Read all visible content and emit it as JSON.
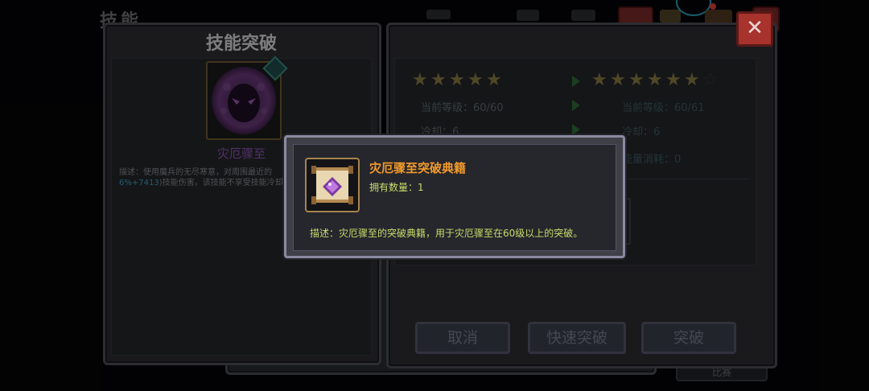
{
  "background_window": {
    "title": "技能"
  },
  "left_panel": {
    "title": "技能突破",
    "skill_name": "灾厄骤至",
    "description_prefix": "描述：使用魔兵的无尽寒意，对周围最近的",
    "description_highlight": "6%+7413",
    "description_suffix": ")技能伤害。该技能不享受技能冷却"
  },
  "right_panel": {
    "current": {
      "stars_filled": 5,
      "stars_total": 5,
      "level_label": "当前等级：",
      "level_value": "60/60",
      "cooldown_label": "冷却：",
      "cooldown_value": "6"
    },
    "next": {
      "stars_filled": 6,
      "stars_total": 7,
      "level_label": "当前等级：",
      "level_value": "60/61",
      "cooldown_label": "冷却：",
      "cooldown_value": "6",
      "energy_label": "能量消耗：",
      "energy_value": "0"
    }
  },
  "buttons": {
    "cancel": "取消",
    "quick_break": "快速突破",
    "break": "突破",
    "close": "✕"
  },
  "behind_panel": {
    "bottom_label": "比赛"
  },
  "item_popup": {
    "name": "灾厄骤至突破典籍",
    "quantity_label": "拥有数量：",
    "quantity_value": "1",
    "description": "描述：灾厄骤至的突破典籍，用于灾厄骤至在60级以上的突破。"
  },
  "colors": {
    "item_name": "#f09a2a",
    "item_text": "#c6de6a",
    "skill_name": "#8e55b5",
    "close_button": "#a8322c"
  }
}
